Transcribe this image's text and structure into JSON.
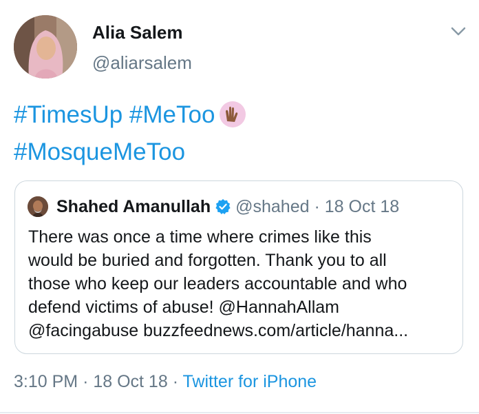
{
  "tweet": {
    "author": {
      "name": "Alia Salem",
      "handle": "@aliarsalem"
    },
    "text_line1": "#TimesUp #MeToo",
    "text_line2": "#MosqueMeToo",
    "emoji": "raising-hands-icon",
    "quoted": {
      "name": "Shahed Amanullah",
      "verified": true,
      "handle": "@shahed",
      "separator": "·",
      "date": "18 Oct 18",
      "body_line1": "There was once a time where crimes like this",
      "body_line2": "would be buried and forgotten. Thank you to all",
      "body_line3": "those who keep our leaders accountable and who",
      "body_line4": "defend victims of abuse! @HannahAllam",
      "body_line5": "@facingabuse buzzfeednews.com/article/hanna..."
    },
    "footer": {
      "time": "3:10 PM",
      "sep1": "·",
      "date": "18 Oct 18",
      "sep2": "·",
      "source": "Twitter for iPhone"
    }
  },
  "colors": {
    "link": "#1b95e0",
    "secondary_text": "#657786",
    "primary_text": "#14171a",
    "border": "#ccd6dd",
    "verified": "#1da1f2"
  }
}
